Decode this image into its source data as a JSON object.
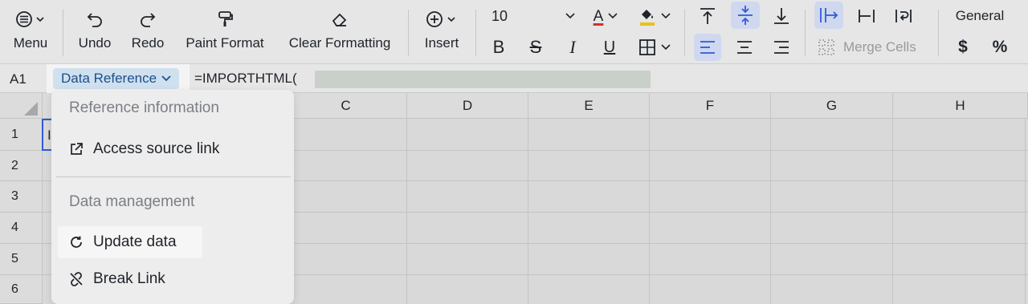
{
  "toolbar": {
    "menu_label": "Menu",
    "undo_label": "Undo",
    "redo_label": "Redo",
    "paint_format_label": "Paint Format",
    "clear_formatting_label": "Clear Formatting",
    "insert_label": "Insert",
    "font_size": "10",
    "merge_cells_label": "Merge Cells",
    "number_format": "General",
    "currency_symbol": "$",
    "percent_symbol": "%",
    "bold_glyph": "B",
    "italic_glyph": "I",
    "underline_glyph": "U",
    "strike_glyph": "S",
    "font_color_glyph": "A",
    "font_color": "#d0312d",
    "fill_color": "#e8c21a"
  },
  "formula_bar": {
    "cell_ref": "A1",
    "data_reference_label": "Data Reference",
    "formula_text": "=IMPORTHTML("
  },
  "grid": {
    "columns": [
      "C",
      "D",
      "E",
      "F",
      "G",
      "H"
    ],
    "rows": [
      "1",
      "2",
      "3",
      "4",
      "5",
      "6"
    ],
    "a1_partial": "I"
  },
  "dropdown": {
    "section1_title": "Reference information",
    "access_source_link": "Access source link",
    "section2_title": "Data management",
    "update_data": "Update data",
    "break_link": "Break Link"
  },
  "colors": {
    "accent": "#2f5bd8",
    "chip_bg": "#cfe0ef"
  }
}
